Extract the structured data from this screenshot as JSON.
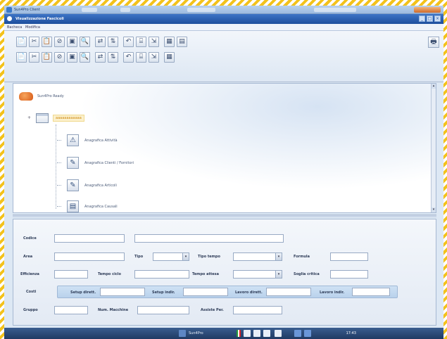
{
  "os_window": {
    "title": "Sun4Pro Client"
  },
  "app": {
    "title": "Visualizzazione Fascicoli",
    "menu": [
      "Bacheca",
      "Modifica"
    ],
    "window_buttons": [
      "_",
      "□",
      "×"
    ]
  },
  "toolbar": {
    "row1": [
      "📄",
      "✂",
      "📋",
      "⊘",
      "▣",
      "🔍",
      "⇄",
      "⇅",
      "↶",
      "⌸",
      "⇲",
      "▦",
      "▤"
    ],
    "row2": [
      "📄",
      "✂",
      "📋",
      "⊘",
      "▣",
      "🔍",
      "⇄",
      "⇅",
      "↶",
      "⌸",
      "⇲",
      "▦"
    ],
    "print_icon": "🖶"
  },
  "tree": {
    "root_label": "Sun4Pro Ready",
    "folder_label": "aaaaaaaaaaaa",
    "expander": "+",
    "children": [
      {
        "icon": "⚠",
        "label": "Anagrafica Attività"
      },
      {
        "icon": "✎",
        "label": "Anagrafica Clienti / Fornitori"
      },
      {
        "icon": "✎",
        "label": "Anagrafica Articoli"
      },
      {
        "icon": "▤",
        "label": "Anagrafica Causali"
      }
    ]
  },
  "form": {
    "codice_label": "Codice",
    "descrizione_value": "",
    "area_label": "Area",
    "tipo_label": "Tipo",
    "tipo_tempo_label": "Tipo tempo",
    "formula_label": "Formula",
    "efficienza_label": "Efficienza",
    "tempo_ciclo_label": "Tempo ciclo",
    "tempo_attesa_label": "Tempo attesa",
    "soglia_critica_label": "Soglia critica",
    "costi_label": "Costi",
    "setup_diretto_label": "Setup dirett.",
    "setup_indiretto_label": "Setup indir.",
    "lavoro_diretto_label": "Lavoro dirett.",
    "lavoro_indiretto_label": "Lavoro indir.",
    "gruppo_label": "Gruppo",
    "num_macchine_label": "Num. Macchine",
    "assiste_per_label": "Assiste Per.",
    "dropdown_glyph": "▾"
  },
  "taskbar": {
    "start_label": "Sun4Pro",
    "clock": "17:43"
  },
  "colors": {
    "titlebar": "#1d4e9c",
    "folder_highlight": "#cf8a10",
    "taskbar": "#1f3a63"
  }
}
